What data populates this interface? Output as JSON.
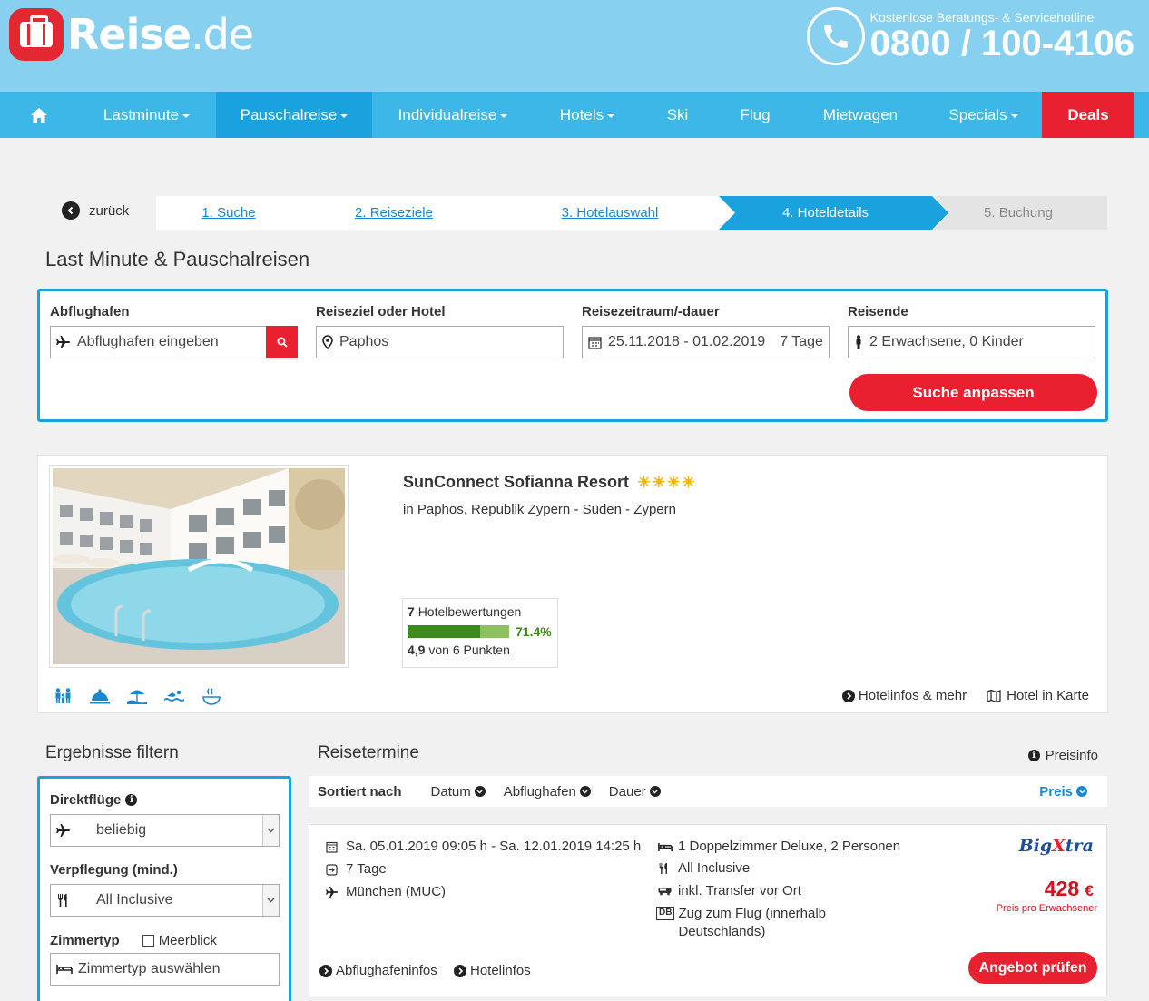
{
  "header": {
    "logo_text_bold": "Reise",
    "logo_text_light": ".de",
    "hotline_label": "Kostenlose Beratungs- & Servicehotline",
    "hotline_number": "0800 / 100-4106"
  },
  "nav": {
    "items": [
      {
        "label": "Lastminute"
      },
      {
        "label": "Pauschalreise"
      },
      {
        "label": "Individualreise"
      },
      {
        "label": "Hotels"
      },
      {
        "label": "Ski"
      },
      {
        "label": "Flug"
      },
      {
        "label": "Mietwagen"
      },
      {
        "label": "Specials"
      },
      {
        "label": "Deals"
      }
    ]
  },
  "steps": {
    "back": "zurück",
    "items": [
      "1. Suche",
      "2. Reiseziele",
      "3. Hotelauswahl",
      "4. Hoteldetails",
      "5. Buchung"
    ]
  },
  "page_title": "Last Minute & Pauschalreisen",
  "search": {
    "departure_label": "Abflughafen",
    "departure_placeholder": "Abflughafen eingeben",
    "destination_label": "Reiseziel oder Hotel",
    "destination_value": "Paphos",
    "period_label": "Reisezeitraum/-dauer",
    "period_value": "25.11.2018 - 01.02.2019",
    "duration_value": "7 Tage",
    "travellers_label": "Reisende",
    "travellers_value": "2 Erwachsene, 0 Kinder",
    "submit_label": "Suche anpassen"
  },
  "hotel": {
    "name": "SunConnect Sofianna Resort",
    "stars": "☀☀☀☀",
    "location": "in Paphos, Republik Zypern - Süden - Zypern",
    "reviews_count": "7",
    "reviews_label": "Hotelbewertungen",
    "recommend_pct": 71.4,
    "recommend_pct_label": "71.4%",
    "score": "4,9",
    "score_label": "von 6 Punkten",
    "link_info": "Hotelinfos & mehr",
    "link_map": "Hotel in Karte"
  },
  "filter": {
    "title": "Ergebnisse filtern",
    "direct_label": "Direktflüge",
    "direct_value": "beliebig",
    "board_label": "Verpflegung (mind.)",
    "board_value": "All Inclusive",
    "room_label": "Zimmertyp",
    "seaview_label": "Meerblick",
    "room_placeholder": "Zimmertyp auswählen"
  },
  "results": {
    "title": "Reisetermine",
    "preisinfo": "Preisinfo",
    "sort_label": "Sortiert nach",
    "sort_options": [
      "Datum",
      "Abflughafen",
      "Dauer"
    ],
    "sort_active": "Preis"
  },
  "offer": {
    "dates": "Sa. 05.01.2019 09:05 h - Sa. 12.01.2019 14:25 h",
    "duration": "7 Tage",
    "airport": "München (MUC)",
    "room": "1 Doppelzimmer Deluxe, 2 Personen",
    "board": "All Inclusive",
    "transfer": "inkl. Transfer vor Ort",
    "train_line1": "Zug zum Flug (innerhalb",
    "train_line2": "Deutschlands)",
    "train_badge": "DB",
    "operator_a": "Big",
    "operator_b": "X",
    "operator_c": "tra",
    "price": "428",
    "currency": "€",
    "price_note": "Preis pro Erwachsener",
    "cta": "Angebot prüfen",
    "link_airport": "Abflughafeninfos",
    "link_hotel": "Hotelinfos"
  }
}
